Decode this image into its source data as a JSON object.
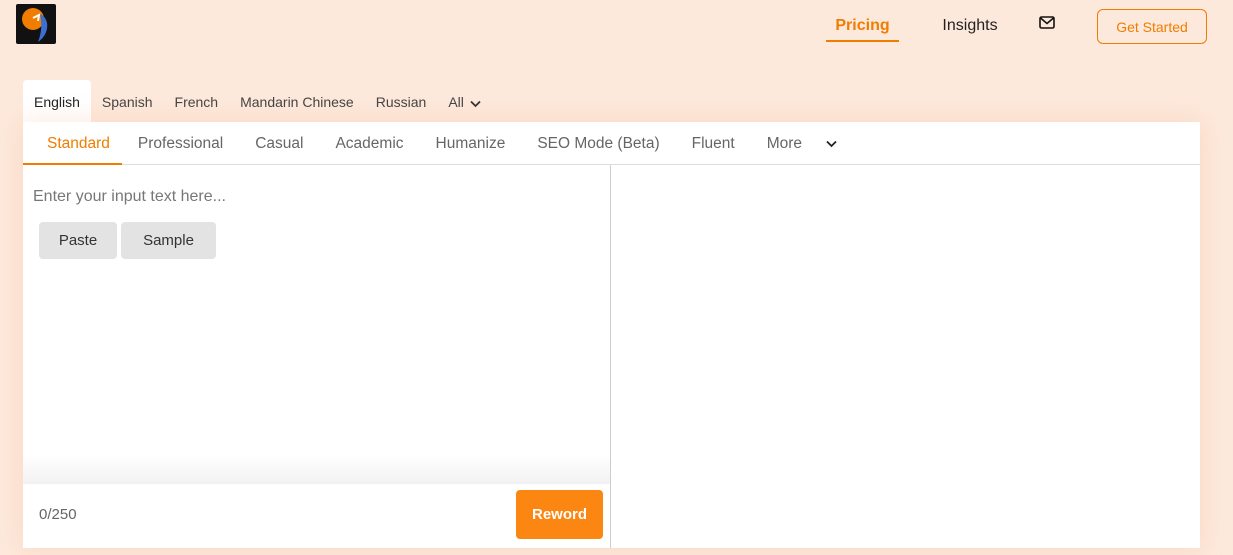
{
  "header": {
    "logo_name": "site-logo",
    "nav": {
      "pricing": "Pricing",
      "insights": "Insights"
    },
    "mail_icon": "mail-icon",
    "get_started": "Get Started"
  },
  "languages": {
    "tabs": [
      "English",
      "Spanish",
      "French",
      "Mandarin Chinese",
      "Russian",
      "All"
    ],
    "active": "English"
  },
  "modes": {
    "tabs": [
      "Standard",
      "Professional",
      "Casual",
      "Academic",
      "Humanize",
      "SEO Mode (Beta)",
      "Fluent",
      "More"
    ],
    "active": "Standard"
  },
  "editor": {
    "placeholder": "Enter your input text here...",
    "paste": "Paste",
    "sample": "Sample",
    "counter": "0/250",
    "reword": "Reword"
  },
  "colors": {
    "accent": "#f07c00",
    "reword_button": "#fb8611",
    "background": "#fde9dc"
  }
}
